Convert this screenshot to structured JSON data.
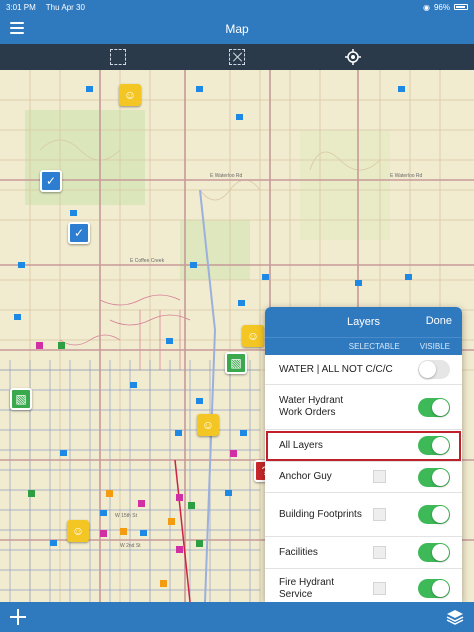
{
  "status": {
    "time": "3:01 PM",
    "date": "Thu Apr 30",
    "battery": "96%"
  },
  "nav": {
    "title": "Map"
  },
  "panel": {
    "title": "Layers",
    "done_label": "Done",
    "col_selectable": "SELECTABLE",
    "col_visible": "VISIBLE",
    "layers": [
      {
        "name": "WATER | ALL NOT C/C/C",
        "selectable": null,
        "visible": false
      },
      {
        "name": "Water Hydrant Work Orders",
        "selectable": null,
        "visible": true
      },
      {
        "name": "All Layers",
        "selectable": null,
        "visible": true,
        "highlighted": true
      },
      {
        "name": "Anchor Guy",
        "selectable": false,
        "visible": true
      },
      {
        "name": "Building Footprints",
        "selectable": false,
        "visible": true
      },
      {
        "name": "Facilities",
        "selectable": false,
        "visible": true
      },
      {
        "name": "Fire Hydrant Service",
        "selectable": false,
        "visible": true
      }
    ]
  },
  "colors": {
    "accent": "#2f79bf",
    "toolbar": "#2b3a4a",
    "toggle_on": "#3eb957",
    "highlight": "#c0202a"
  },
  "icons": [
    "menu-icon",
    "select-area-icon",
    "clear-selection-icon",
    "locate-icon",
    "add-icon",
    "layers-icon"
  ]
}
